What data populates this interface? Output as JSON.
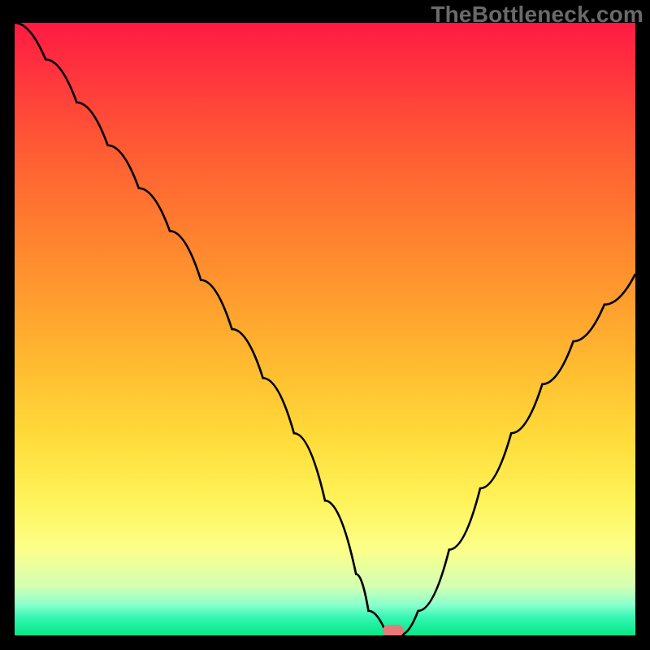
{
  "watermark": "TheBottleneck.com",
  "chart_data": {
    "type": "line",
    "title": "",
    "xlabel": "",
    "ylabel": "",
    "xlim": [
      0,
      100
    ],
    "ylim": [
      0,
      100
    ],
    "x": [
      0,
      5,
      10,
      15,
      20,
      25,
      30,
      35,
      40,
      45,
      50,
      55,
      57,
      60,
      62,
      65,
      70,
      75,
      80,
      85,
      90,
      95,
      100
    ],
    "values": [
      100,
      94,
      87,
      80,
      73,
      66,
      58,
      50,
      42,
      33,
      22,
      10,
      4,
      0,
      0,
      4,
      14,
      24,
      33,
      41,
      48,
      54,
      59
    ],
    "notch_x": 61,
    "notch_color": "#E67A78",
    "gradient_stops": [
      {
        "pos": 0.0,
        "color": "#ff1a43"
      },
      {
        "pos": 0.2,
        "color": "#ff5934"
      },
      {
        "pos": 0.44,
        "color": "#ff9a2e"
      },
      {
        "pos": 0.68,
        "color": "#ffdc3a"
      },
      {
        "pos": 0.86,
        "color": "#fbff8a"
      },
      {
        "pos": 0.97,
        "color": "#36f6b3"
      },
      {
        "pos": 1.0,
        "color": "#05e887"
      }
    ]
  }
}
